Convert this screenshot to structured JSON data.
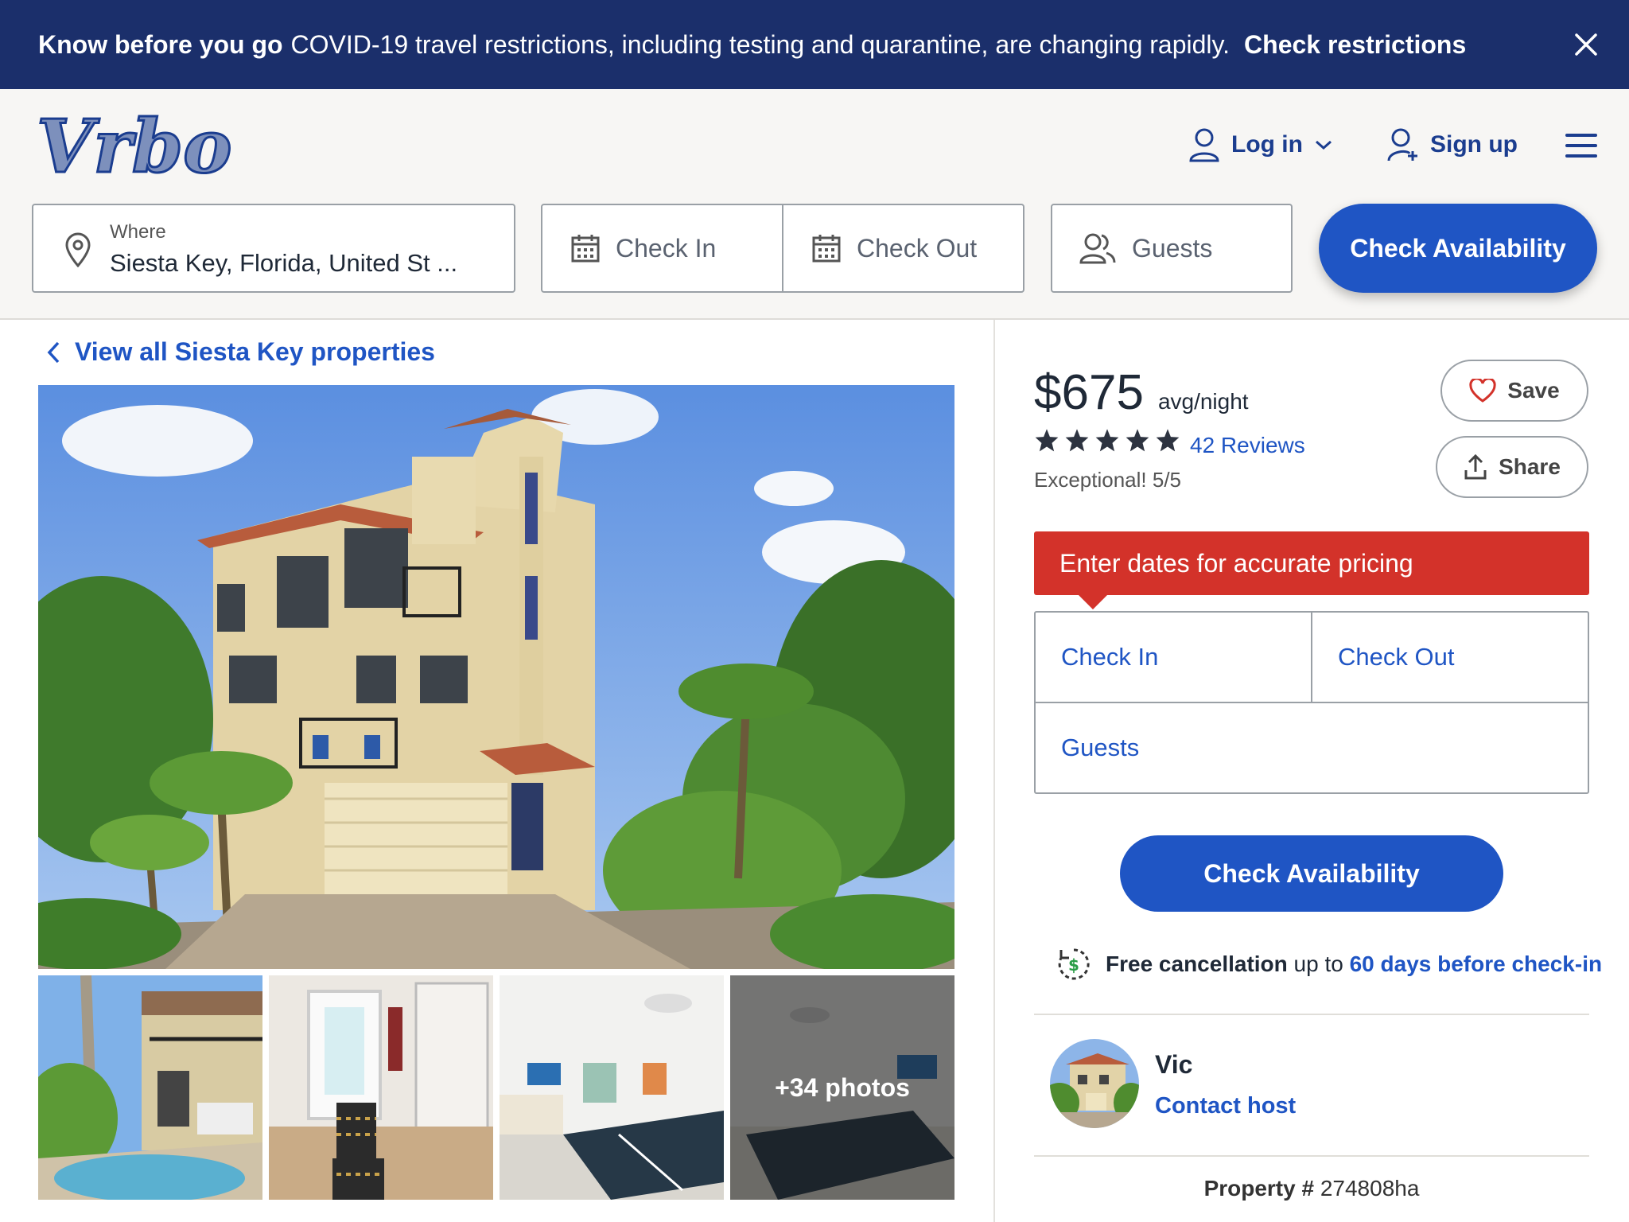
{
  "banner": {
    "strong_text": "Know before you go",
    "message": "COVID-19 travel restrictions, including testing and quarantine, are changing rapidly.",
    "cta": "Check restrictions"
  },
  "header": {
    "logo_text": "Vrbo",
    "login_label": "Log in",
    "signup_label": "Sign up"
  },
  "search": {
    "where_label": "Where",
    "where_value": "Siesta Key, Florida, United St ...",
    "check_in": "Check In",
    "check_out": "Check Out",
    "guests": "Guests",
    "submit": "Check Availability"
  },
  "listing": {
    "back_link": "View all Siesta Key properties",
    "more_photos": "+34 photos"
  },
  "pricing": {
    "amount": "$675",
    "unit": "avg/night",
    "stars": 5,
    "reviews": "42 Reviews",
    "rating_text": "Exceptional! 5/5",
    "save_label": "Save",
    "share_label": "Share",
    "alert": "Enter dates for accurate pricing",
    "check_in": "Check In",
    "check_out": "Check Out",
    "guests": "Guests",
    "submit": "Check Availability",
    "cancel_bold": "Free cancellation",
    "cancel_mid": "up to",
    "cancel_link": "60 days before check-in"
  },
  "host": {
    "name": "Vic",
    "contact": "Contact host"
  },
  "property": {
    "label": "Property #",
    "id": "274808ha"
  },
  "colors": {
    "brand_blue": "#1f55c4",
    "banner_navy": "#1b2f6b",
    "alert_red": "#d3322a"
  }
}
